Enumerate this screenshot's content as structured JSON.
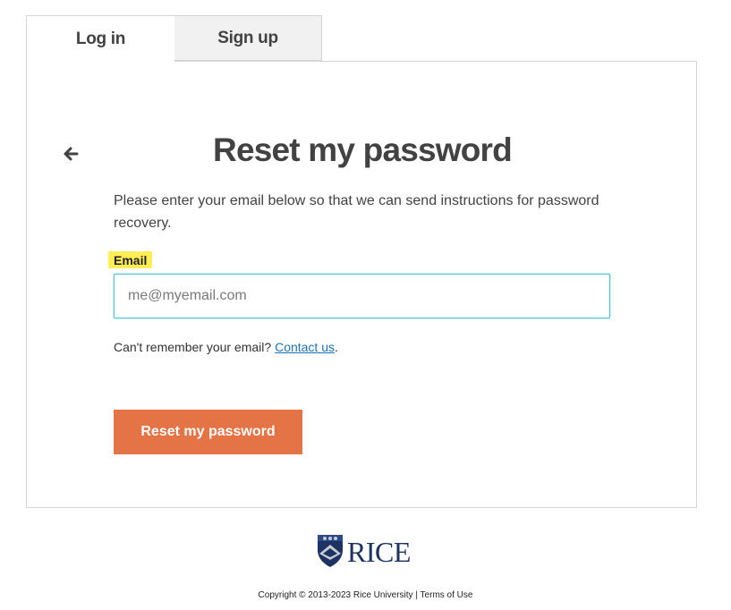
{
  "tabs": {
    "login": "Log in",
    "signup": "Sign up"
  },
  "heading": "Reset my password",
  "instructions": "Please enter your email below so that we can send instructions for password recovery.",
  "email": {
    "label": "Email",
    "placeholder": "me@myemail.com",
    "value": ""
  },
  "help": {
    "text": "Can't remember your email? ",
    "link": "Contact us",
    "suffix": "."
  },
  "reset_button": "Reset my password",
  "footer": {
    "logo_text": "RICE",
    "copyright": "Copyright © 2013-2023 Rice University",
    "separator": " | ",
    "terms": "Terms of Use"
  },
  "colors": {
    "accent": "#e47446",
    "link": "#1a73b8",
    "highlight": "#ffee55",
    "focus_border": "#4fc3d8",
    "rice_blue": "#1d3363"
  },
  "icons": {
    "back": "arrow-left-icon",
    "logo": "rice-owl-shield-icon"
  }
}
